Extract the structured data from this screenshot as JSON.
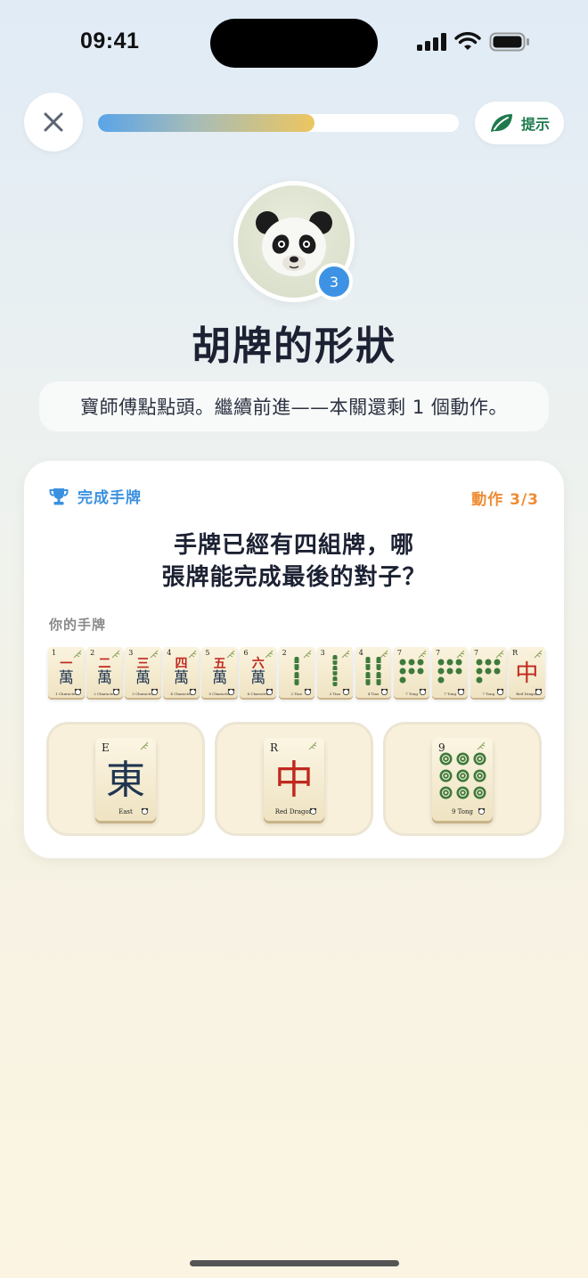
{
  "status_bar": {
    "time": "09:41"
  },
  "header": {
    "progress": 0.6,
    "hint_label": "提示"
  },
  "lesson": {
    "level": "3",
    "title": "胡牌的形狀",
    "subtitle": "寶師傅點點頭。繼續前進——本關還剩 1 個動作。"
  },
  "card": {
    "label": "完成手牌",
    "step": "動作 3/3",
    "question_line1": "手牌已經有四組牌，哪",
    "question_line2": "張牌能完成最後的對子？",
    "hand_label": "你的手牌"
  },
  "hand": [
    {
      "corner": "1",
      "top": "一",
      "bottom": "萬",
      "caption": "1 Character"
    },
    {
      "corner": "2",
      "top": "二",
      "bottom": "萬",
      "caption": "2 Character"
    },
    {
      "corner": "3",
      "top": "三",
      "bottom": "萬",
      "caption": "3 Character"
    },
    {
      "corner": "4",
      "top": "四",
      "bottom": "萬",
      "caption": "4 Character"
    },
    {
      "corner": "5",
      "top": "五",
      "bottom": "萬",
      "caption": "5 Character"
    },
    {
      "corner": "6",
      "top": "六",
      "bottom": "萬",
      "caption": "6 Character"
    },
    {
      "corner": "2",
      "caption": "2 Tiao"
    },
    {
      "corner": "3",
      "caption": "3 Tiao"
    },
    {
      "corner": "4",
      "caption": "4 Tiao"
    },
    {
      "corner": "7",
      "caption": "7 Tong"
    },
    {
      "corner": "7",
      "caption": "7 Tong"
    },
    {
      "corner": "7",
      "caption": "7 Tong"
    },
    {
      "corner": "R",
      "glyph": "中",
      "caption": "Red Dragon"
    }
  ],
  "options": [
    {
      "corner": "E",
      "glyph": "東",
      "caption": "East"
    },
    {
      "corner": "R",
      "glyph": "中",
      "caption": "Red Dragon"
    },
    {
      "corner": "9",
      "caption": "9 Tong"
    }
  ],
  "colors": {
    "accent_blue": "#3d92e4",
    "accent_orange": "#ef8c33",
    "hint_green": "#1e7a4d",
    "dragon_red": "#c0281f",
    "wind_ink": "#1f3550",
    "bamboo_green": "#3d7a3b"
  }
}
